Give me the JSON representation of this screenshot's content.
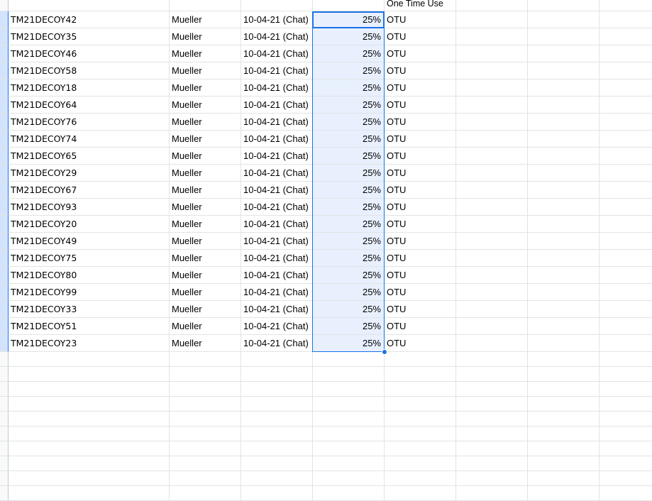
{
  "header_row": {
    "col_f": "One Time Use"
  },
  "rows": [
    {
      "code": "TM21DECOY42",
      "name": "Mueller",
      "date": "10-04-21 (Chat)",
      "pct": "25%",
      "type": "OTU"
    },
    {
      "code": "TM21DECOY35",
      "name": "Mueller",
      "date": "10-04-21 (Chat)",
      "pct": "25%",
      "type": "OTU"
    },
    {
      "code": "TM21DECOY46",
      "name": "Mueller",
      "date": "10-04-21 (Chat)",
      "pct": "25%",
      "type": "OTU"
    },
    {
      "code": "TM21DECOY58",
      "name": "Mueller",
      "date": "10-04-21 (Chat)",
      "pct": "25%",
      "type": "OTU"
    },
    {
      "code": "TM21DECOY18",
      "name": "Mueller",
      "date": "10-04-21 (Chat)",
      "pct": "25%",
      "type": "OTU"
    },
    {
      "code": "TM21DECOY64",
      "name": "Mueller",
      "date": "10-04-21 (Chat)",
      "pct": "25%",
      "type": "OTU"
    },
    {
      "code": "TM21DECOY76",
      "name": "Mueller",
      "date": "10-04-21 (Chat)",
      "pct": "25%",
      "type": "OTU"
    },
    {
      "code": "TM21DECOY74",
      "name": "Mueller",
      "date": "10-04-21 (Chat)",
      "pct": "25%",
      "type": "OTU"
    },
    {
      "code": "TM21DECOY65",
      "name": "Mueller",
      "date": "10-04-21 (Chat)",
      "pct": "25%",
      "type": "OTU"
    },
    {
      "code": "TM21DECOY29",
      "name": "Mueller",
      "date": "10-04-21 (Chat)",
      "pct": "25%",
      "type": "OTU"
    },
    {
      "code": "TM21DECOY67",
      "name": "Mueller",
      "date": "10-04-21 (Chat)",
      "pct": "25%",
      "type": "OTU"
    },
    {
      "code": "TM21DECOY93",
      "name": "Mueller",
      "date": "10-04-21 (Chat)",
      "pct": "25%",
      "type": "OTU"
    },
    {
      "code": "TM21DECOY20",
      "name": "Mueller",
      "date": "10-04-21 (Chat)",
      "pct": "25%",
      "type": "OTU"
    },
    {
      "code": "TM21DECOY49",
      "name": "Mueller",
      "date": "10-04-21 (Chat)",
      "pct": "25%",
      "type": "OTU"
    },
    {
      "code": "TM21DECOY75",
      "name": "Mueller",
      "date": "10-04-21 (Chat)",
      "pct": "25%",
      "type": "OTU"
    },
    {
      "code": "TM21DECOY80",
      "name": "Mueller",
      "date": "10-04-21 (Chat)",
      "pct": "25%",
      "type": "OTU"
    },
    {
      "code": "TM21DECOY99",
      "name": "Mueller",
      "date": "10-04-21 (Chat)",
      "pct": "25%",
      "type": "OTU"
    },
    {
      "code": "TM21DECOY33",
      "name": "Mueller",
      "date": "10-04-21 (Chat)",
      "pct": "25%",
      "type": "OTU"
    },
    {
      "code": "TM21DECOY51",
      "name": "Mueller",
      "date": "10-04-21 (Chat)",
      "pct": "25%",
      "type": "OTU"
    },
    {
      "code": "TM21DECOY23",
      "name": "Mueller",
      "date": "10-04-21 (Chat)",
      "pct": "25%",
      "type": "OTU"
    }
  ],
  "empty_row_count": 10,
  "colors": {
    "selection_border": "#1a73e8",
    "selection_fill": "#e8f0fe",
    "gridline": "#e2e3e3"
  }
}
